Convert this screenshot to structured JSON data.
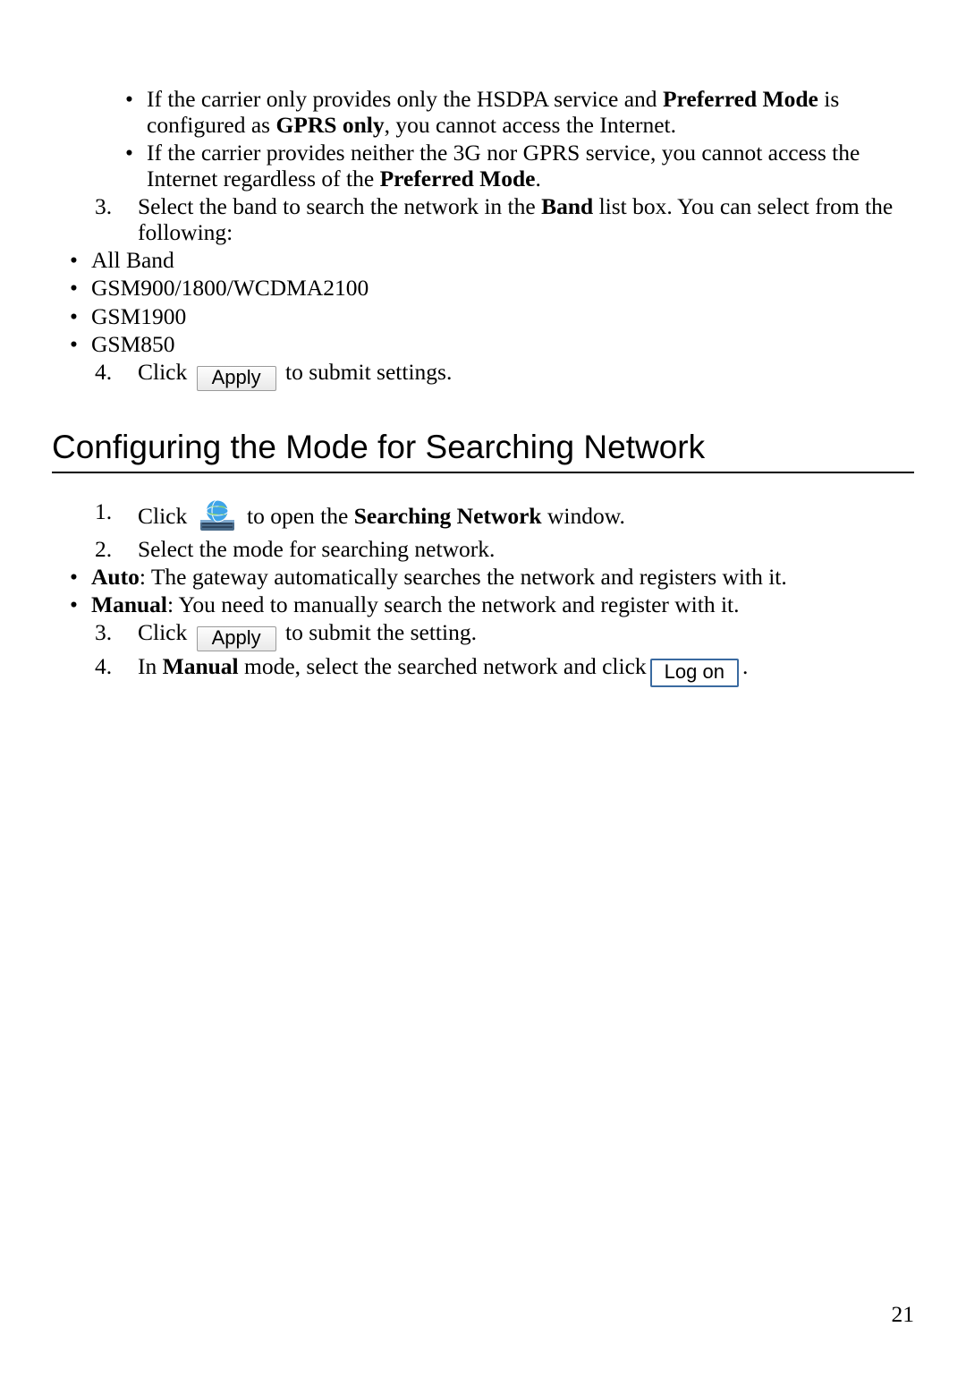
{
  "notes": {
    "hsdpa": {
      "pre": "If the carrier only provides only the HSDPA service and ",
      "bold1": "Preferred Mode",
      "mid": " is configured as ",
      "bold2": "GPRS only",
      "post": ", you cannot access the Internet."
    },
    "no3g": {
      "pre": "If the carrier provides neither the 3G nor GPRS service, you cannot access the Internet regardless of the ",
      "bold1": "Preferred Mode",
      "post": "."
    }
  },
  "step3": {
    "num": "3.",
    "pre": "Select the band to search the network in the ",
    "bold": "Band",
    "post": " list box. You can select from the following:"
  },
  "bands": {
    "b1": "All Band",
    "b2": "GSM900/1800/WCDMA2100",
    "b3": "GSM1900",
    "b4": "GSM850"
  },
  "step4_top": {
    "num": "4.",
    "pre": "Click ",
    "btn": "Apply",
    "post": " to submit settings."
  },
  "heading": "Configuring the Mode for Searching Network",
  "s1": {
    "num": "1.",
    "pre": "Click ",
    "mid": " to open the ",
    "bold": "Searching Network",
    "post": " window."
  },
  "s2": {
    "num": "2.",
    "text": "Select the mode for searching network."
  },
  "s2a": {
    "bold": "Auto",
    "text": ": The gateway automatically searches the network and registers with it."
  },
  "s2b": {
    "bold": "Manual",
    "text": ": You need to manually search the network and register with it."
  },
  "s3": {
    "num": "3.",
    "pre": "Click ",
    "btn": "Apply",
    "post": " to submit the setting."
  },
  "s4": {
    "num": "4.",
    "pre": "In ",
    "bold": "Manual",
    "mid": " mode, select the searched network and click",
    "btn": "Log on",
    "post": "."
  },
  "page_number": "21",
  "bullet": "•"
}
